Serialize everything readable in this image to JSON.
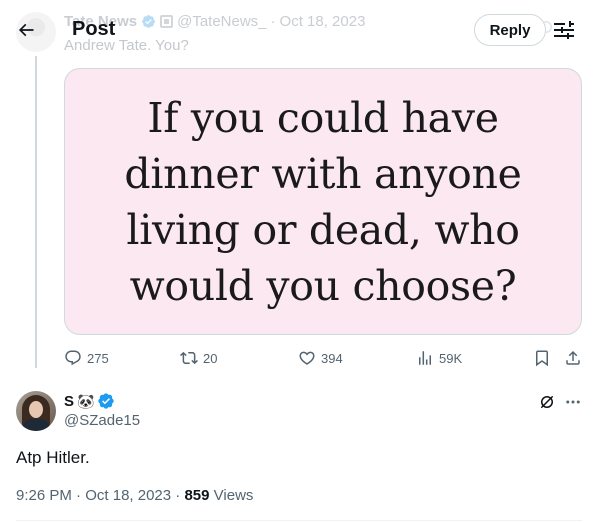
{
  "nav": {
    "title": "Post",
    "reply_label": "Reply"
  },
  "parent_tweet": {
    "display_name": "Tate News",
    "handle": "@TateNews_",
    "date": "Oct 18, 2023",
    "separator": "·",
    "text": "Andrew Tate. You?",
    "image_text": "If you could have\ndinner with anyone\nliving or dead, who\nwould you choose?",
    "image_bg": "#fce8f0",
    "stats": {
      "replies": "275",
      "reposts": "20",
      "likes": "394",
      "views": "59K"
    }
  },
  "reply_tweet": {
    "display_name": "S",
    "name_emoji": "🐼",
    "handle": "@SZade15",
    "text": "Atp Hitler.",
    "time": "9:26 PM",
    "date": "Oct 18, 2023",
    "separator": "·",
    "views_count": "859",
    "views_label": "Views"
  },
  "icons": {
    "back": "arrow-left-icon",
    "settings": "sliders-icon",
    "verified": "verified-badge-icon",
    "reply": "speech-bubble-icon",
    "repost": "repost-icon",
    "like": "heart-icon",
    "views": "bar-chart-icon",
    "bookmark": "bookmark-icon",
    "share": "share-icon",
    "grok": "grok-icon",
    "more": "more-horizontal-icon"
  },
  "colors": {
    "accent": "#1d9bf0",
    "text": "#0f1419",
    "muted": "#536471"
  }
}
